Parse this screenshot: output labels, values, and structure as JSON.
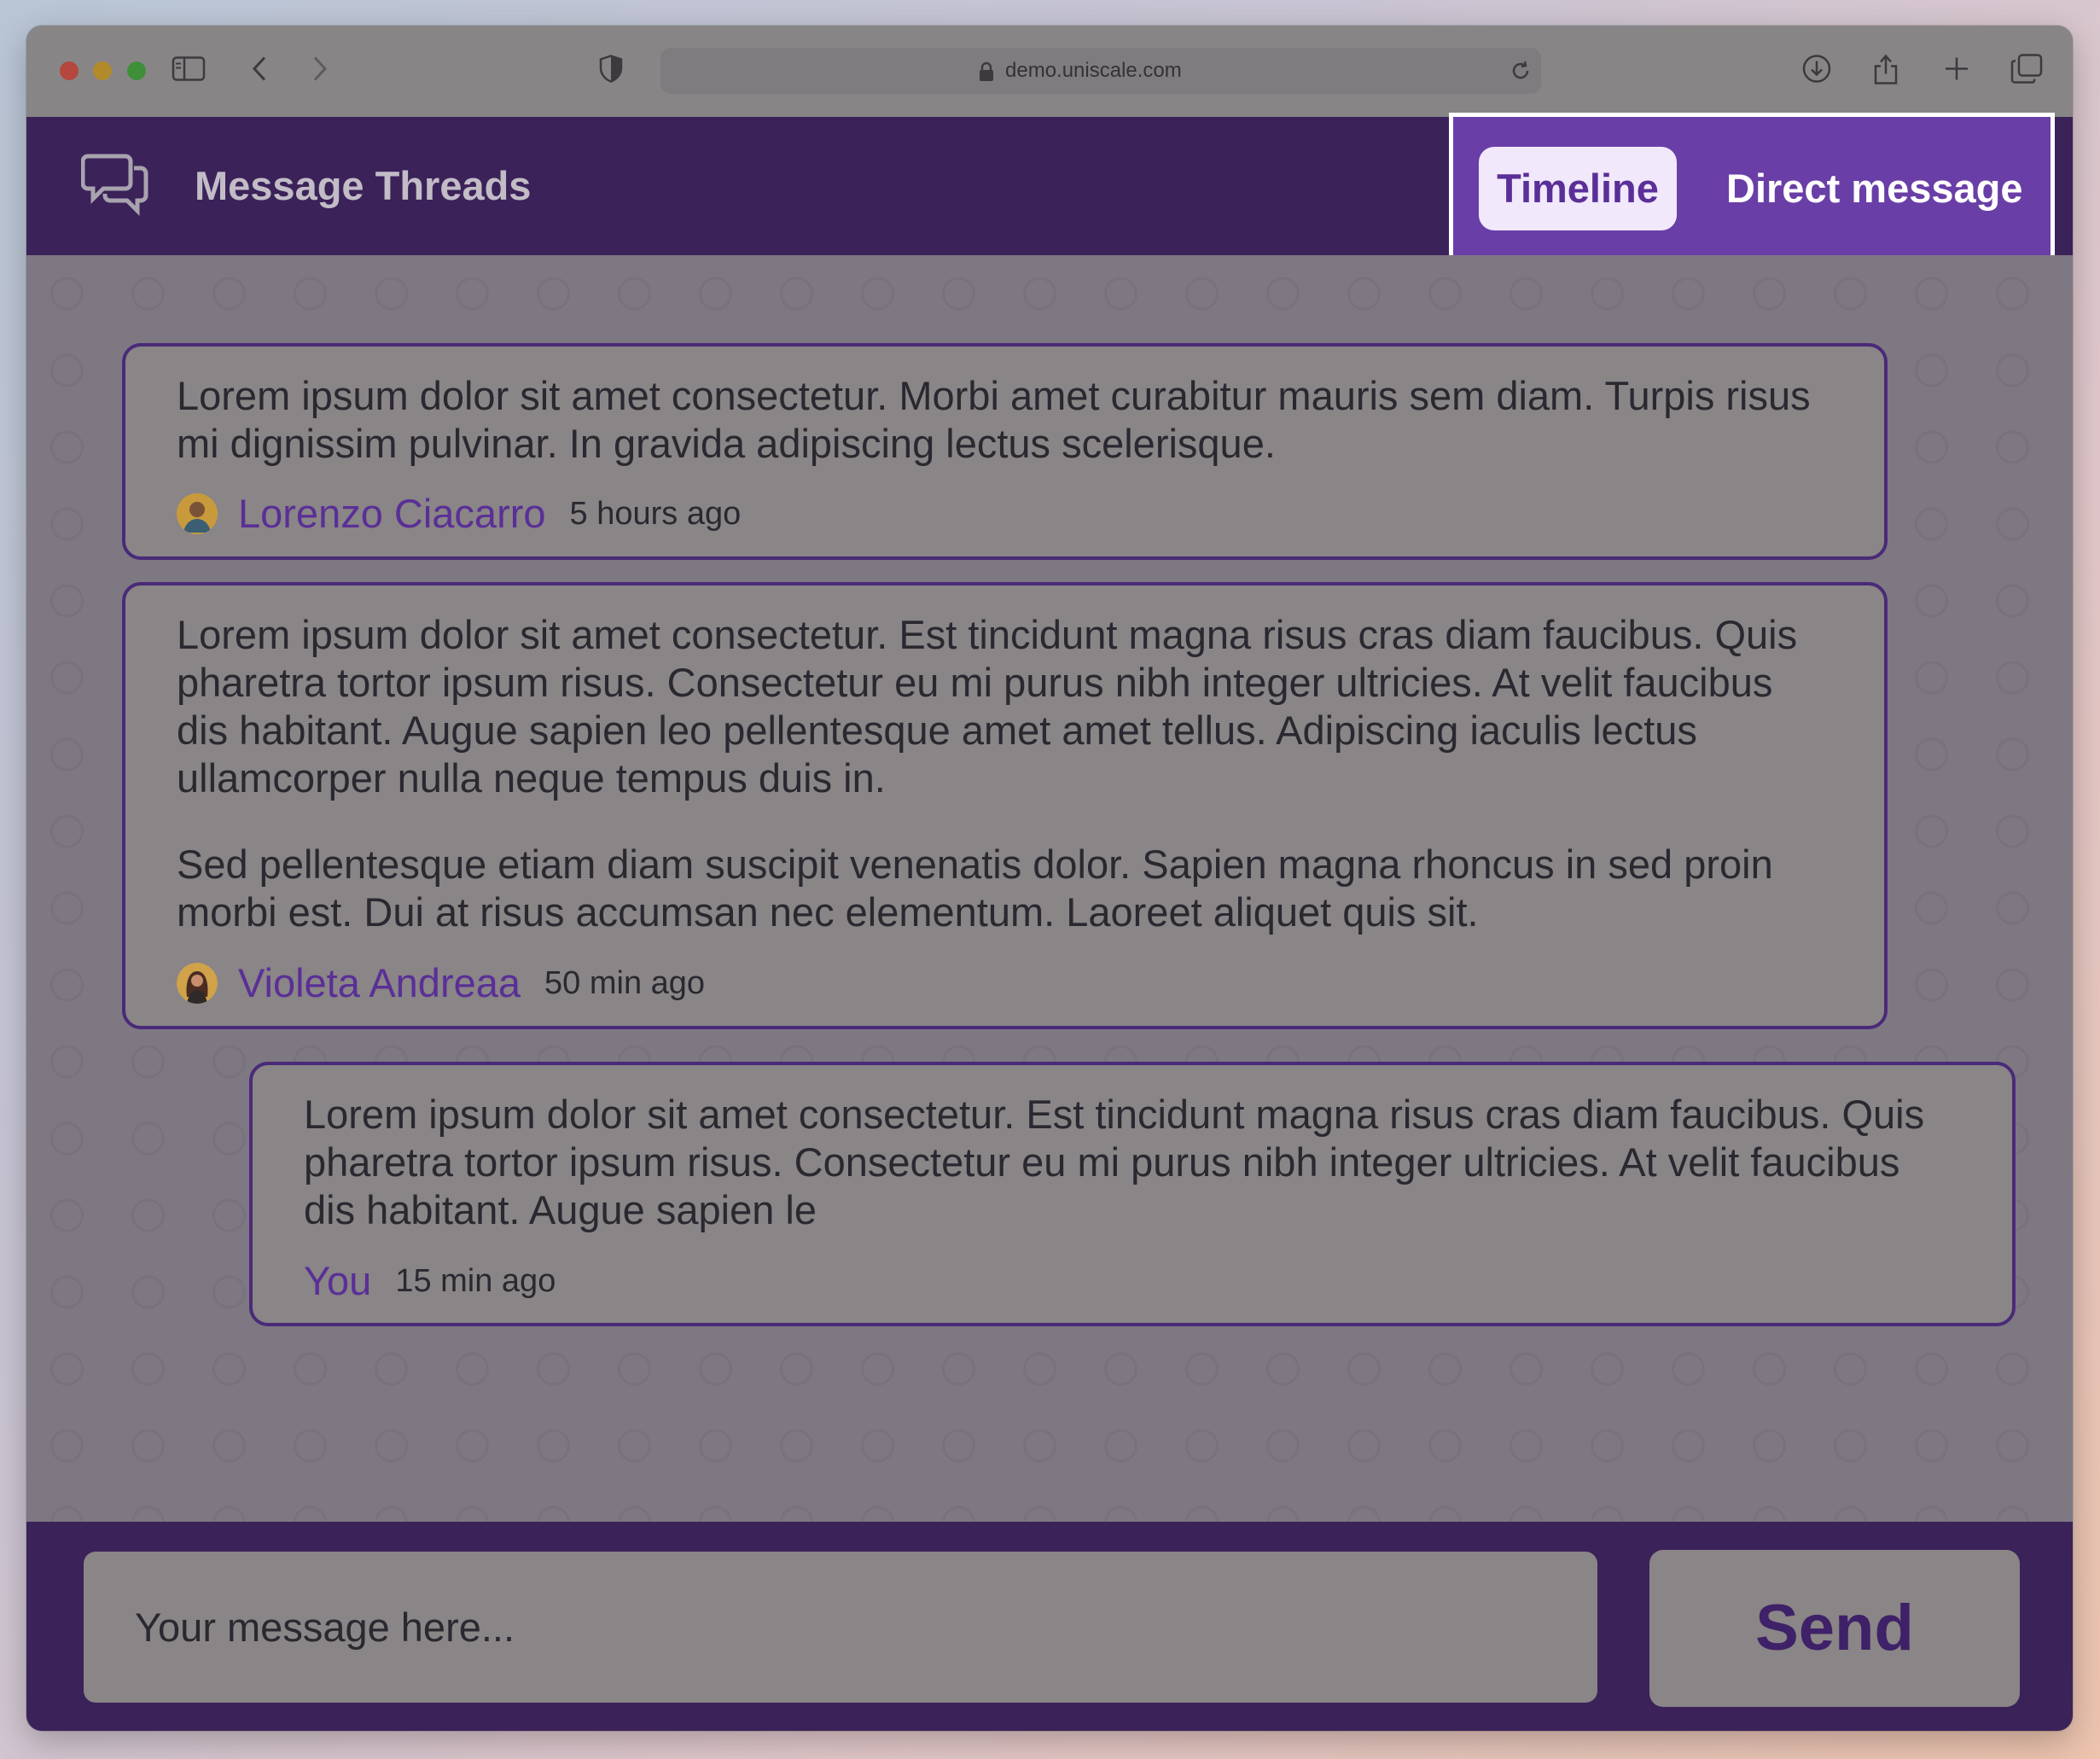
{
  "browser": {
    "url": "demo.uniscale.com",
    "icons": [
      "sidebar-icon",
      "back-arrow-icon",
      "forward-arrow-icon",
      "shield-icon",
      "lock-icon",
      "reload-icon",
      "download-icon",
      "share-icon",
      "new-tab-plus-icon",
      "tabs-overview-icon"
    ]
  },
  "header": {
    "title": "Message Threads",
    "logo_icon": "chat-bubbles-icon",
    "tabs": [
      {
        "label": "Timeline",
        "active": true
      },
      {
        "label": "Direct message",
        "active": false
      }
    ]
  },
  "messages": [
    {
      "paragraphs": [
        "Lorem ipsum dolor sit amet consectetur. Morbi amet curabitur mauris sem diam. Turpis risus mi dignissim pulvinar. In gravida adipiscing lectus scelerisque."
      ],
      "author": "Lorenzo Ciacarro",
      "time": "5 hours ago"
    },
    {
      "paragraphs": [
        "Lorem ipsum dolor sit amet consectetur. Est tincidunt magna risus cras diam faucibus. Quis pharetra tortor ipsum risus. Consectetur eu mi purus nibh integer ultricies. At velit faucibus dis habitant. Augue sapien leo pellentesque amet amet tellus. Adipiscing iaculis lectus ullamcorper nulla neque tempus duis in.",
        "Sed pellentesque etiam diam suscipit venenatis dolor. Sapien magna rhoncus in sed proin morbi est. Dui at risus accumsan nec elementum. Laoreet aliquet quis sit."
      ],
      "author": "Violeta Andreaa",
      "time": "50 min ago"
    },
    {
      "paragraphs": [
        "Lorem ipsum dolor sit amet consectetur. Est tincidunt magna risus cras diam faucibus. Quis pharetra tortor ipsum risus. Consectetur eu mi purus nibh integer ultricies. At velit faucibus dis habitant. Augue sapien le"
      ],
      "author": "You",
      "time": "15 min ago"
    }
  ],
  "composer": {
    "placeholder": "Your message here...",
    "send_label": "Send"
  },
  "colors": {
    "header_bg": "#3b2259",
    "accent": "#6a3ea7",
    "author": "#5a2f97"
  }
}
